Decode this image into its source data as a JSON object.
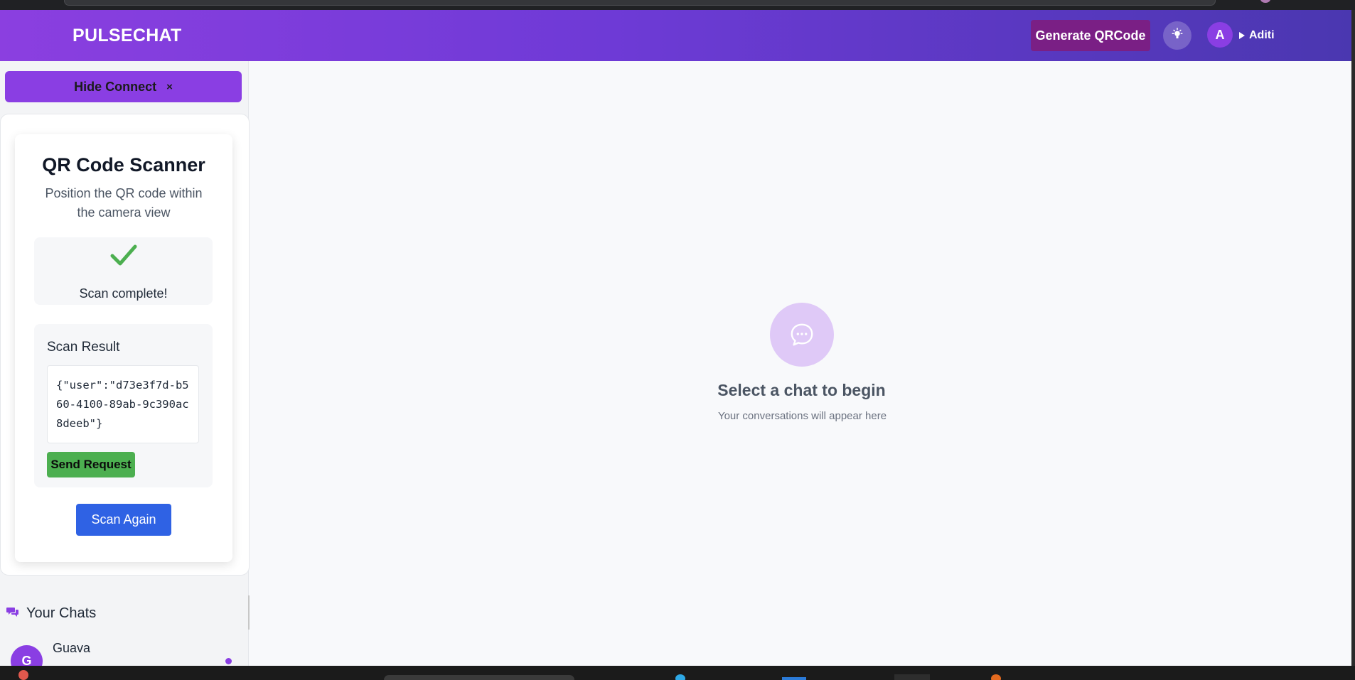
{
  "header": {
    "brand": "PULSECHAT",
    "generate_button": "Generate QRCode",
    "avatar_initial": "A",
    "username": "Aditi"
  },
  "sidebar": {
    "hide_button": "Hide Connect",
    "hide_button_icon": "×",
    "scanner": {
      "title": "QR Code Scanner",
      "subtitle": "Position the QR code within the camera view",
      "status": "Scan complete!",
      "result_title": "Scan Result",
      "result_value": "{\"user\":\"d73e3f7d-b560-4100-89ab-9c390ac8deeb\"}",
      "send_button": "Send Request",
      "scan_again_button": "Scan Again"
    },
    "chats": {
      "heading": "Your Chats",
      "items": [
        {
          "initial": "G",
          "name": "Guava"
        }
      ]
    }
  },
  "main": {
    "empty_title": "Select a chat to begin",
    "empty_subtitle": "Your conversations will appear here"
  },
  "colors": {
    "accent": "#8a3ee3",
    "header_gradient_start": "#8b3fe0",
    "header_gradient_end": "#4a37b0",
    "generate_button": "#7a1f85",
    "send_button": "#4caf50",
    "scan_again_button": "#2f62e4",
    "success_check": "#4caf50"
  },
  "icons": {
    "theme": "lightbulb-icon",
    "success": "checkmark-icon",
    "empty_state": "chat-bubble-icon",
    "chats_heading": "chat-bubbles-icon",
    "floating": "extension-bolt-icon"
  }
}
